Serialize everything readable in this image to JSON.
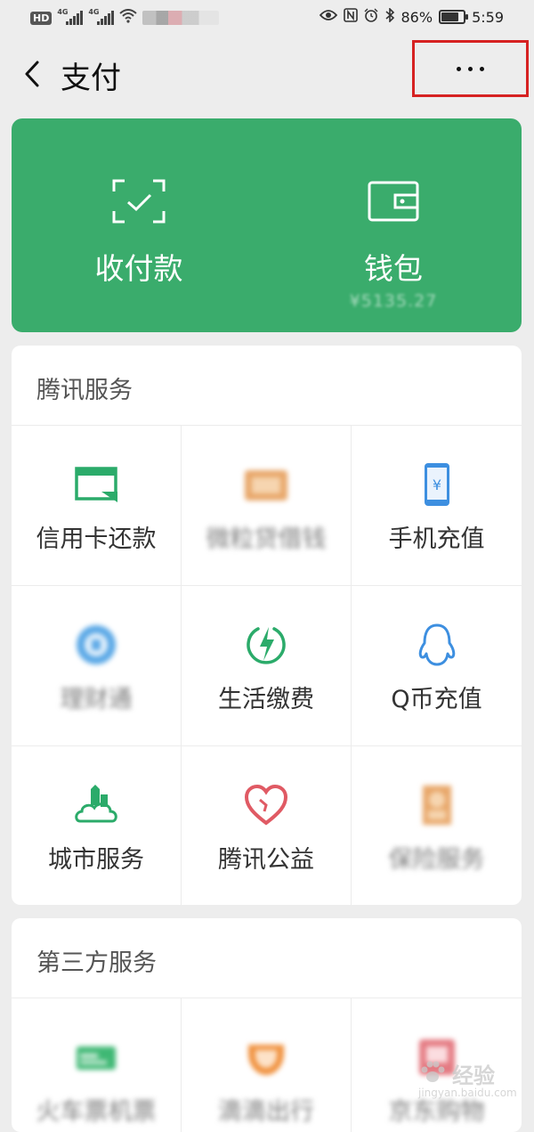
{
  "status_bar": {
    "hd": "HD",
    "net1": "4G",
    "net2": "4G",
    "battery_percent": "86%",
    "battery_level": 0.86,
    "time": "5:59"
  },
  "header": {
    "title": "支付"
  },
  "pay_card": {
    "collect_label": "收付款",
    "wallet_label": "钱包",
    "wallet_balance": "¥5135.27",
    "color": "#3aac6c"
  },
  "tencent_services": {
    "title": "腾讯服务",
    "items": [
      {
        "label": "信用卡还款",
        "icon": "credit-card-icon"
      },
      {
        "label": "微粒贷借钱",
        "icon": "loan-icon"
      },
      {
        "label": "手机充值",
        "icon": "phone-recharge-icon"
      },
      {
        "label": "理财通",
        "icon": "wealth-icon"
      },
      {
        "label": "生活缴费",
        "icon": "utility-bill-icon"
      },
      {
        "label": "Q币充值",
        "icon": "qq-penguin-icon"
      },
      {
        "label": "城市服务",
        "icon": "city-service-icon"
      },
      {
        "label": "腾讯公益",
        "icon": "charity-heart-icon"
      },
      {
        "label": "保险服务",
        "icon": "insurance-icon"
      }
    ]
  },
  "third_party_services": {
    "title": "第三方服务",
    "items": [
      {
        "label": "火车票机票",
        "icon": "train-ticket-icon"
      },
      {
        "label": "滴滴出行",
        "icon": "didi-icon"
      },
      {
        "label": "京东购物",
        "icon": "jd-shopping-icon"
      }
    ]
  },
  "watermark": {
    "brand": "经验",
    "url": "jingyan.baidu.com"
  }
}
